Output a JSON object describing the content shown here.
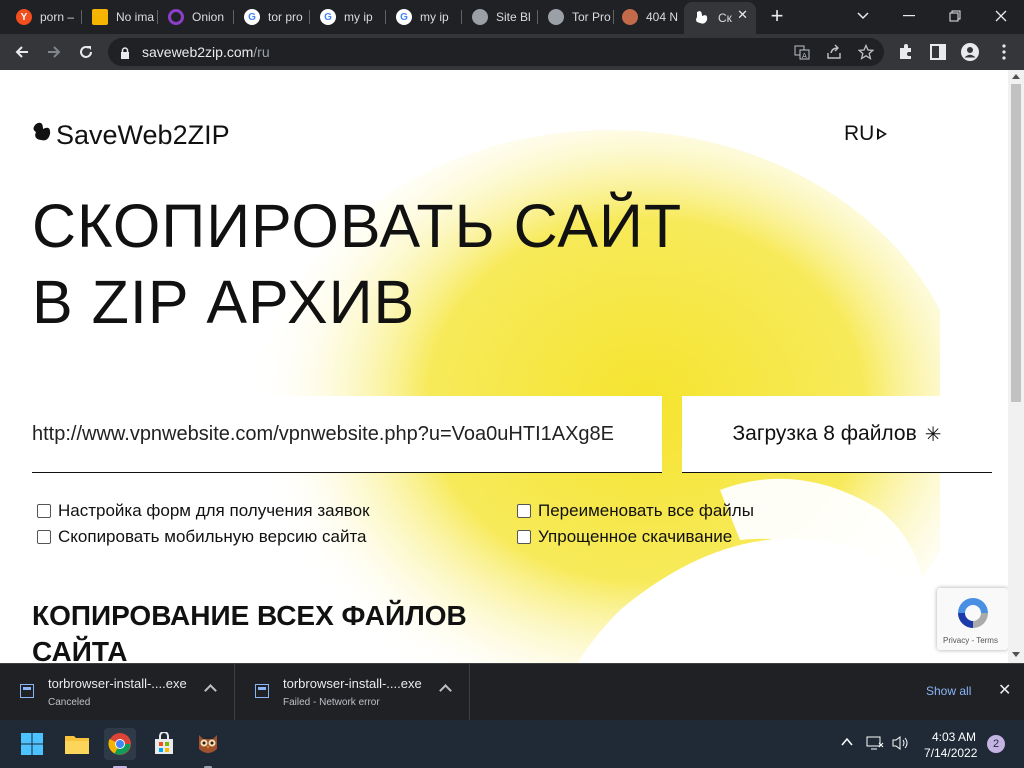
{
  "browser": {
    "tabs": [
      {
        "title": "porn –",
        "icon": "yandex-icon",
        "color": "#f24e1e",
        "glyph": "Y"
      },
      {
        "title": "No ima",
        "icon": "folder-image-icon",
        "color": "#f5b400",
        "glyph": ""
      },
      {
        "title": "Onion",
        "icon": "tor-onion-icon",
        "color": "#7d4698",
        "glyph": ""
      },
      {
        "title": "tor pro",
        "icon": "google-icon",
        "color": "#ffffff",
        "glyph": "G"
      },
      {
        "title": "my ip",
        "icon": "google-icon",
        "color": "#ffffff",
        "glyph": "G"
      },
      {
        "title": "my ip",
        "icon": "google-icon",
        "color": "#ffffff",
        "glyph": "G"
      },
      {
        "title": "Site Bl",
        "icon": "globe-icon",
        "color": "#9aa0a6",
        "glyph": ""
      },
      {
        "title": "Tor Pro",
        "icon": "globe-icon",
        "color": "#9aa0a6",
        "glyph": ""
      },
      {
        "title": "404 N",
        "icon": "round-logo-icon",
        "color": "#c26a4a",
        "glyph": ""
      },
      {
        "title": "Ск",
        "icon": "saveweb2zip-icon",
        "color": "#111111",
        "glyph": ""
      }
    ],
    "url_host": "saveweb2zip.com",
    "url_path": "/ru"
  },
  "page": {
    "logo": "SaveWeb2ZIP",
    "lang": "RU",
    "hero_line1": "СКОПИРОВАТЬ САЙТ",
    "hero_line2": "В ZIP АРХИВ",
    "url_value": "http://www.vpnwebsite.com/vpnwebsite.php?u=Voa0uHTI1AXg8E",
    "download_label": "Загрузка 8 файлов",
    "download_star": "✳",
    "options": [
      "Настройка форм для получения заявок",
      "Скопировать мобильную версию сайта",
      "Переименовать все файлы",
      "Упрощенное скачивание"
    ],
    "section_line1": "КОПИРОВАНИЕ ВСЕХ ФАЙЛОВ",
    "section_line2": "САЙТА",
    "recaptcha_text": "Privacy - Terms",
    "accent_color": "#f5e42f"
  },
  "downloads": {
    "items": [
      {
        "name": "torbrowser-install-....exe",
        "status": "Canceled"
      },
      {
        "name": "torbrowser-install-....exe",
        "status": "Failed - Network error"
      }
    ],
    "show_all": "Show all"
  },
  "taskbar": {
    "time": "4:03 AM",
    "date": "7/14/2022",
    "notifications": "2"
  }
}
